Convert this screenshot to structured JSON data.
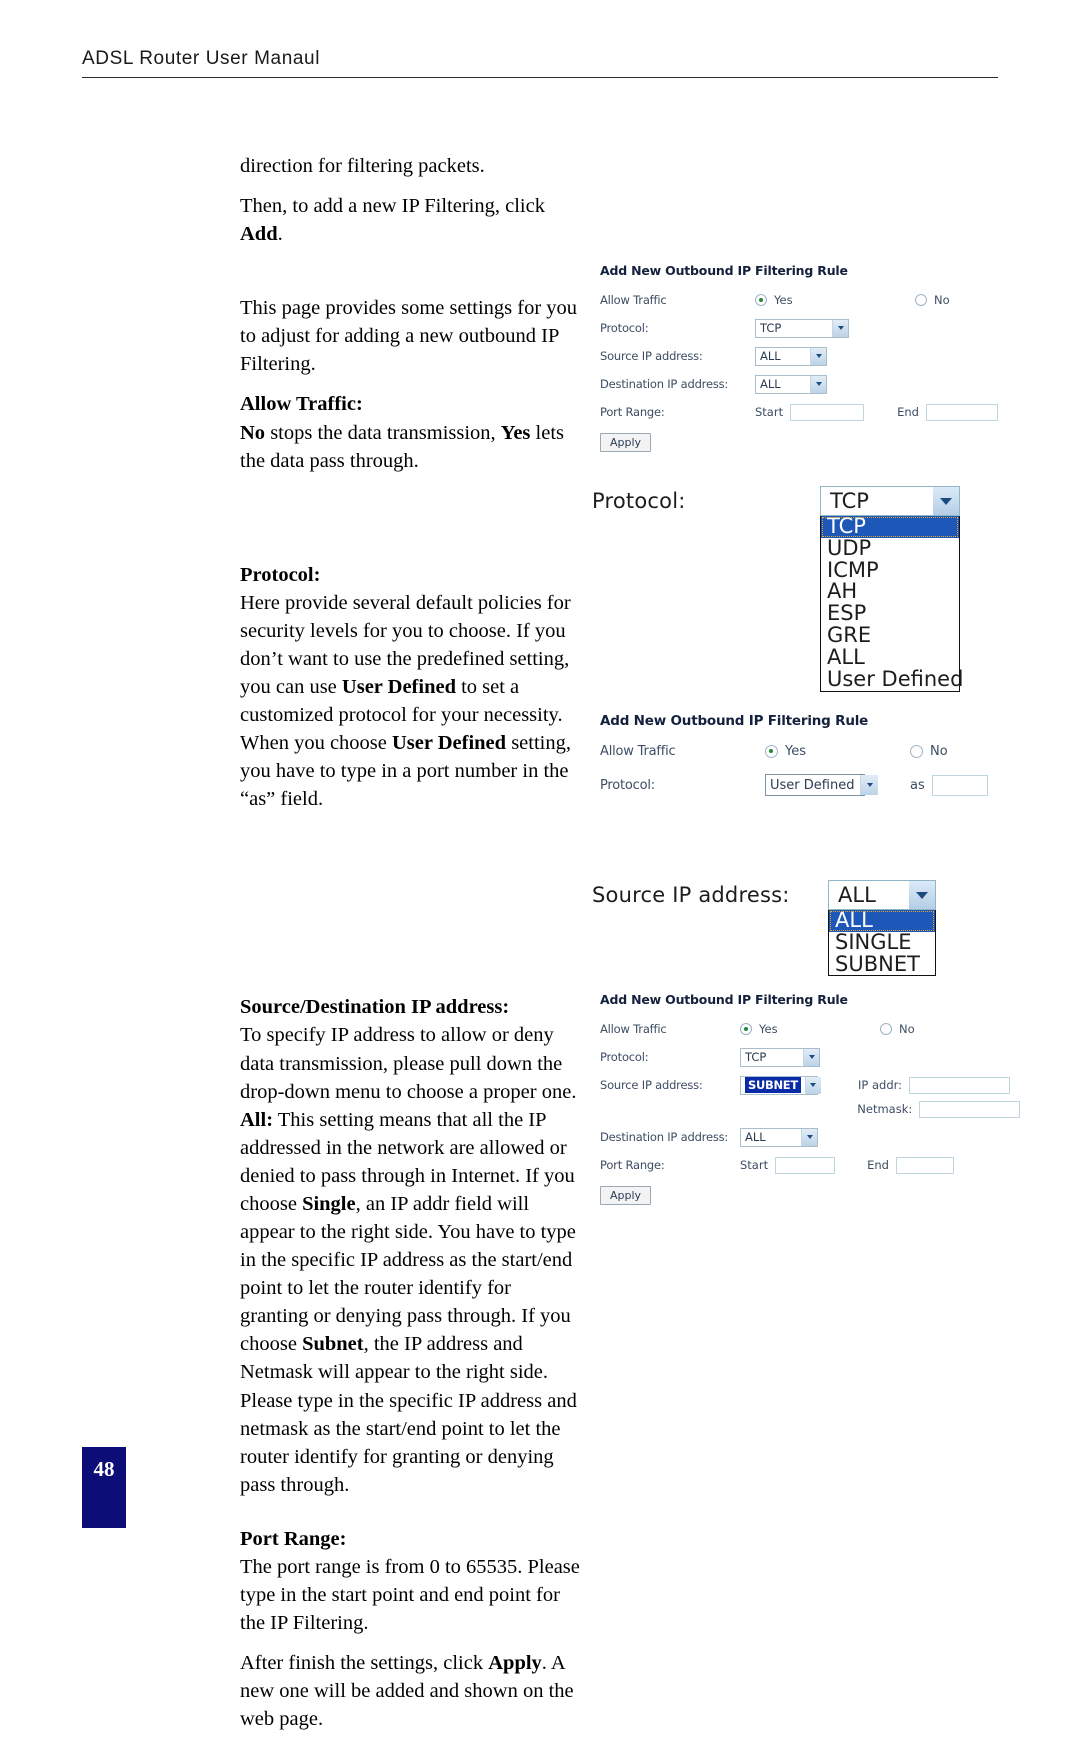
{
  "header": {
    "title": "ADSL Router User Manaul"
  },
  "body_text": {
    "p1": "direction for filtering packets.",
    "p2_a": "Then, to add a new IP Filtering, click ",
    "p2_b": "Add",
    "p2_c": ".",
    "p3": "This page provides some settings for you to adjust for adding a new outbound IP Filtering.",
    "allow_traffic_heading": "Allow Traffic:",
    "allow_traffic_1": "No",
    "allow_traffic_2": " stops the data transmission, ",
    "allow_traffic_3": "Yes",
    "allow_traffic_4": " lets the data pass through.",
    "protocol_heading": "Protocol:",
    "protocol_1": "Here provide several default policies for security levels for you to choose. If you don’t want to use the predefined setting, you can use ",
    "protocol_2": "User Defined",
    "protocol_3": " to set a customized protocol for your necessity. When you choose ",
    "protocol_4": "User Defined",
    "protocol_5": " setting, you have to type in a port number in the “as” field.",
    "srcdst_heading": "Source/Destination IP address:",
    "srcdst_1": "To specify IP address to allow or deny data transmission, please pull down the drop-down menu to choose a proper one. ",
    "srcdst_2": "All:",
    "srcdst_3": " This setting means that all the IP addressed in the network are allowed or denied to pass through in Internet. If you choose ",
    "srcdst_4": "Single",
    "srcdst_5": ", an IP addr field will appear to the right side. You have to type in the specific IP address as the start/end point to let the router identify for granting or denying pass through. If you choose ",
    "srcdst_6": "Subnet",
    "srcdst_7": ", the IP address and Netmask will appear to the right side. Please type in the specific IP address and netmask as the start/end point to let the router identify for granting or denying pass through.",
    "port_range_heading": "Port Range:",
    "port_range_1": "The port range is from 0 to 65535. Please type in the start point and end point for the IP Filtering.",
    "apply_1": "After finish the settings, click ",
    "apply_2": "Apply",
    "apply_3": ".   A new one will be added and shown on the web page."
  },
  "figure1": {
    "title": "Add New Outbound IP Filtering Rule",
    "allow_traffic_label": "Allow Traffic",
    "radio_yes": "Yes",
    "radio_no": "No",
    "protocol_label": "Protocol:",
    "protocol_value": "TCP",
    "source_label": "Source IP address:",
    "source_value": "ALL",
    "dest_label": "Destination IP address:",
    "dest_value": "ALL",
    "port_range_label": "Port Range:",
    "start_label": "Start",
    "start_value": "",
    "end_label": "End",
    "end_value": "",
    "apply_label": "Apply"
  },
  "protocol_zoom": {
    "label": "Protocol:",
    "selected": "TCP",
    "options": [
      "TCP",
      "UDP",
      "ICMP",
      "AH",
      "ESP",
      "GRE",
      "ALL",
      "User Defined"
    ]
  },
  "figure2": {
    "title": "Add New Outbound IP Filtering Rule",
    "allow_traffic_label": "Allow Traffic",
    "radio_yes": "Yes",
    "radio_no": "No",
    "protocol_label": "Protocol:",
    "protocol_value": "User Defined",
    "as_label": "as",
    "as_value": ""
  },
  "source_zoom": {
    "label": "Source IP address:",
    "selected": "ALL",
    "options": [
      "ALL",
      "SINGLE",
      "SUBNET"
    ]
  },
  "figure3": {
    "title": "Add New Outbound IP Filtering Rule",
    "allow_traffic_label": "Allow Traffic",
    "radio_yes": "Yes",
    "radio_no": "No",
    "protocol_label": "Protocol:",
    "protocol_value": "TCP",
    "source_label": "Source IP address:",
    "source_value": "SUBNET",
    "ip_addr_label": "IP addr:",
    "ip_addr_value": "",
    "netmask_label": "Netmask:",
    "netmask_value": "",
    "dest_label": "Destination IP address:",
    "dest_value": "ALL",
    "port_range_label": "Port Range:",
    "start_label": "Start",
    "start_value": "",
    "end_label": "End",
    "end_value": "",
    "apply_label": "Apply"
  },
  "footer": {
    "page_number": "48"
  },
  "colors": {
    "page_number_box": "#0d0d77",
    "ui_label": "#3d4d63",
    "ui_title": "#14213d",
    "highlight_blue": "#1d58b8",
    "radio_on_green": "#1f8a3c"
  }
}
